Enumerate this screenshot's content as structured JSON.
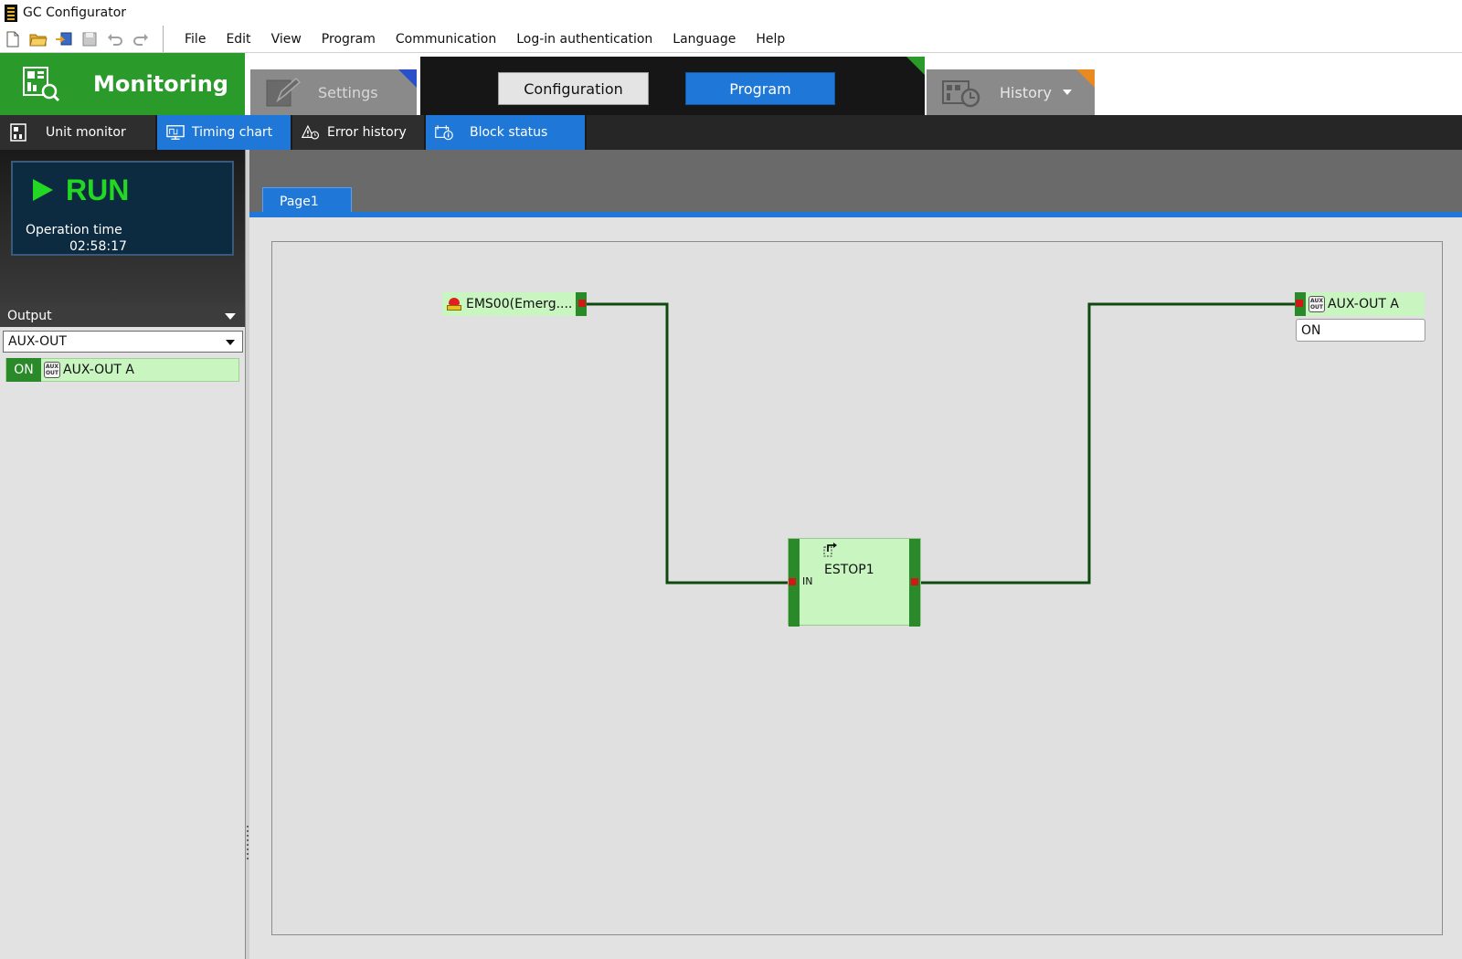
{
  "window": {
    "title": "GC Configurator"
  },
  "menu": {
    "items": [
      "File",
      "Edit",
      "View",
      "Program",
      "Communication",
      "Log-in authentication",
      "Language",
      "Help"
    ]
  },
  "main_tabs": {
    "monitoring": "Monitoring",
    "settings": "Settings",
    "configuration": "Configuration",
    "program": "Program",
    "history": "History"
  },
  "sub_tabs": {
    "unit_monitor": "Unit monitor",
    "timing_chart": "Timing chart",
    "error_history": "Error history",
    "block_status": "Block status"
  },
  "status": {
    "state": "RUN",
    "operation_time_label": "Operation time",
    "operation_time": "02:58:17"
  },
  "output_panel": {
    "header": "Output",
    "selected": "AUX-OUT",
    "rows": [
      {
        "state": "ON",
        "icon_text": "AUX OUT",
        "label": "AUX-OUT A"
      }
    ]
  },
  "canvas": {
    "page_tab": "Page1",
    "blocks": {
      "ems": {
        "label": "EMS00(Emerg....",
        "icon": "emergency-stop-icon"
      },
      "estop": {
        "name": "ESTOP1",
        "input_label": "IN"
      },
      "aux_out": {
        "label": "AUX-OUT A",
        "icon_text": "AUX OUT",
        "status": "ON"
      }
    }
  },
  "colors": {
    "monitoring_green": "#2a9a2a",
    "accent_blue": "#1f78d8",
    "block_fill": "#c8f5c0",
    "terminal_red": "#d01818",
    "run_green": "#22d822"
  }
}
